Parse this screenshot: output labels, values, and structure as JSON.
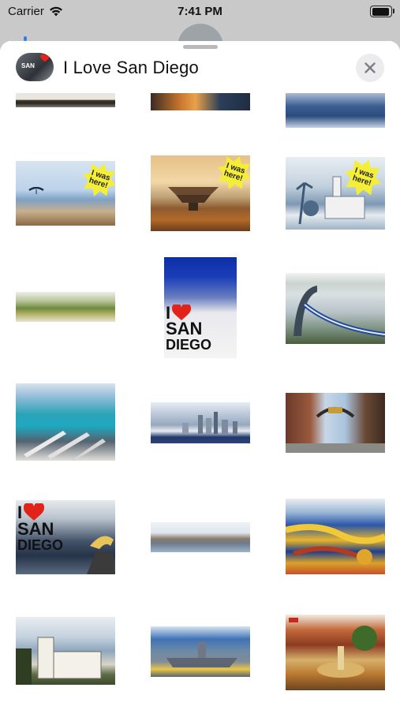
{
  "status_bar": {
    "carrier": "Carrier",
    "time": "7:41 PM"
  },
  "header": {
    "title": "I Love San Diego",
    "app_icon_text": "SAN"
  },
  "stickers": {
    "tag_line1": "I was",
    "tag_line2": "here!",
    "ilove_i": "I",
    "ilove_san": "SAN",
    "ilove_diego": "DIEGO"
  },
  "colors": {
    "sheet_bg": "#ffffff",
    "dim_bg": "#c9c9c9",
    "heart": "#e2231a",
    "tag_yellow": "#f4ef36",
    "close_bg": "#ececef"
  }
}
